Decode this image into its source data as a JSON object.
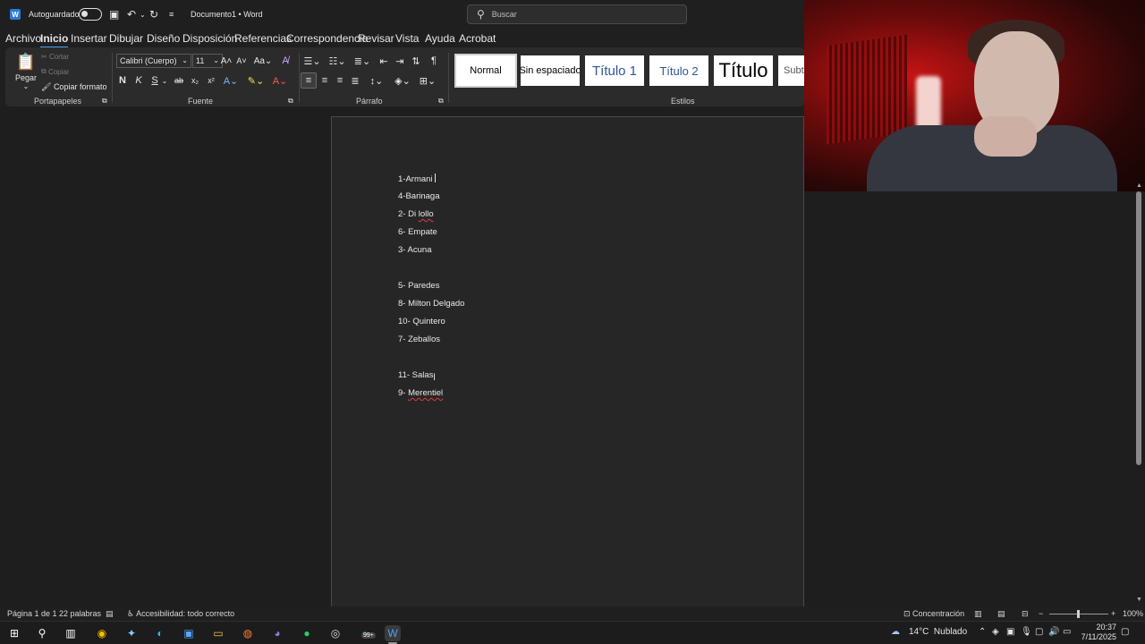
{
  "titlebar": {
    "autosave_label": "Autoguardado",
    "doc_title": "Documento1",
    "separator": "•",
    "app_name": "Word",
    "search_placeholder": "Buscar"
  },
  "menu": [
    "Archivo",
    "Inicio",
    "Insertar",
    "Dibujar",
    "Diseño",
    "Disposición",
    "Referencias",
    "Correspondencia",
    "Revisar",
    "Vista",
    "Ayuda",
    "Acrobat"
  ],
  "menu_active": "Inicio",
  "ribbon": {
    "clipboard": {
      "paste": "Pegar",
      "cut": "Cortar",
      "copy": "Copiar",
      "format_painter": "Copiar formato",
      "label": "Portapapeles"
    },
    "font": {
      "font_name": "Calibri (Cuerpo)",
      "font_size": "11",
      "grow": "A^",
      "shrink": "Aˇ",
      "case": "Aa",
      "bold": "N",
      "italic": "K",
      "underline": "S",
      "strike": "ab",
      "sub": "x₂",
      "sup": "x²",
      "label": "Fuente"
    },
    "paragraph": {
      "label": "Párrafo"
    },
    "styles": {
      "label": "Estilos",
      "items": [
        "Normal",
        "Sin espaciado",
        "Título 1",
        "Título 2",
        "Título",
        "Subt"
      ]
    }
  },
  "document": {
    "lines": [
      "1-Armani",
      "4-Barinaga",
      "2- Di",
      "lollo",
      "6- Empate",
      "3- Acuna",
      "5- Paredes",
      "8- Milton Delgado",
      "10- Quintero",
      "7- Zeballos",
      "11- Salas",
      "9-",
      "Merentiel"
    ]
  },
  "status": {
    "page": "Página 1 de 1",
    "words": "22 palabras",
    "accessibility": "Accesibilidad: todo correcto",
    "focus": "Concentración",
    "zoom_minus": "−",
    "zoom_plus": "+",
    "zoom": "100%"
  },
  "taskbar": {
    "weather_temp": "14°C",
    "weather_text": "Nublado",
    "time": "20:37",
    "date": "7/11/2025",
    "badge": "99+"
  },
  "colors": {
    "accent": "#4ea1f3",
    "word_blue": "#2b7cd3",
    "spell_error": "#e03b3b"
  }
}
